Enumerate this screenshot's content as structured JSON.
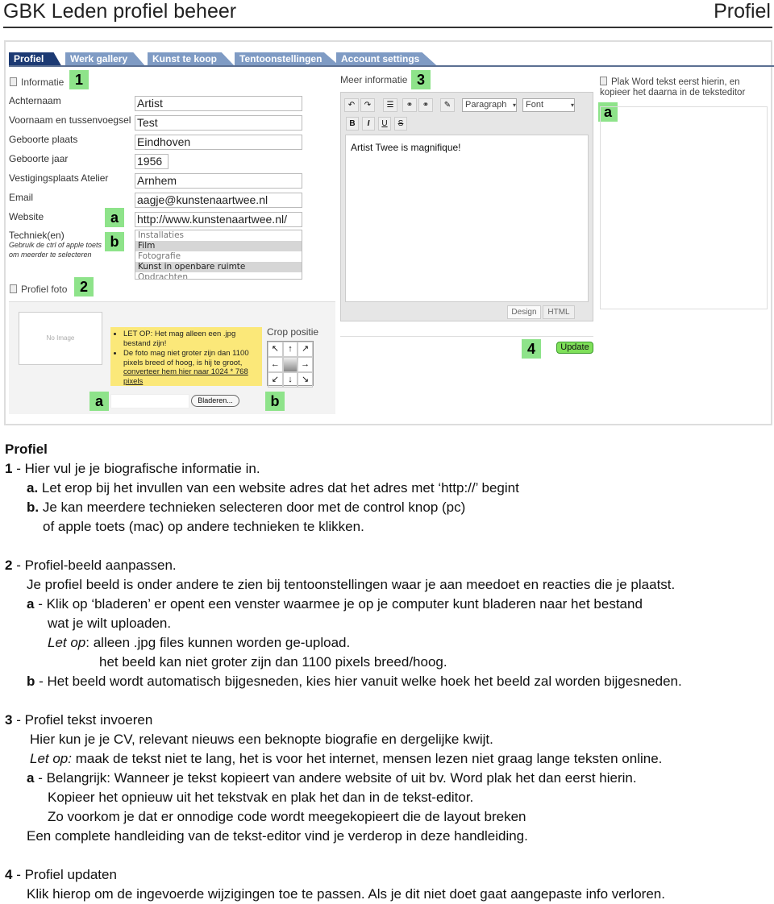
{
  "header": {
    "title": "GBK Leden profiel beheer",
    "right": "Profiel"
  },
  "tabs": [
    {
      "label": "Profiel",
      "active": true
    },
    {
      "label": "Werk gallery"
    },
    {
      "label": "Kunst te koop"
    },
    {
      "label": "Tentoonstellingen"
    },
    {
      "label": "Account settings"
    }
  ],
  "info": {
    "heading": "Informatie",
    "badge": "1",
    "fields": [
      {
        "label": "Achternaam",
        "value": "Artist"
      },
      {
        "label": "Voornaam en tussenvoegsel",
        "value": "Test"
      },
      {
        "label": "Geboorte plaats",
        "value": "Eindhoven"
      },
      {
        "label": "Geboorte jaar",
        "value": "1956"
      },
      {
        "label": "Vestigingsplaats Atelier",
        "value": "Arnhem"
      },
      {
        "label": "Email",
        "value": "aagje@kunstenaartwee.nl"
      },
      {
        "label": "Website",
        "value": "http://www.kunstenaartwee.nl/",
        "badge": "a"
      }
    ],
    "techniek": {
      "label": "Techniek(en)",
      "hint": "Gebruik de ctrl of apple toets om meerder te selecteren",
      "badge": "b",
      "options": [
        {
          "label": "Installaties",
          "selected": false
        },
        {
          "label": "Film",
          "selected": true
        },
        {
          "label": "Fotografie",
          "selected": false
        },
        {
          "label": "Kunst in openbare ruimte",
          "selected": true
        },
        {
          "label": "Opdrachten",
          "selected": false
        }
      ]
    }
  },
  "photo": {
    "heading": "Profiel foto",
    "badge": "2",
    "no_image": "No Image",
    "notes": [
      "LET OP: Het mag alleen een .jpg bestand zijn!",
      "De foto mag niet groter zijn dan 1100 pixels breed of hoog, is hij te groot,"
    ],
    "note_link": "converteer hem hier naar 1024 * 768 pixels",
    "crop_label": "Crop positie",
    "browse": "Bladeren...",
    "badge_a": "a",
    "badge_b": "b"
  },
  "editor": {
    "heading": "Meer informatie",
    "badge": "3",
    "paragraph": "Paragraph",
    "font": "Font",
    "bold": "B",
    "italic": "I",
    "underline": "U",
    "strike": "S",
    "content": "Artist Twee is magnifique!",
    "design_tab": "Design",
    "html_tab": "HTML"
  },
  "paste": {
    "label": "Plak Word tekst eerst hierin, en kopieer het daarna in de teksteditor",
    "badge": "a"
  },
  "update": {
    "label": "Update",
    "badge": "4"
  },
  "doc": {
    "title": "Profiel",
    "l1p": "1",
    "l1": " - Hier vul je je biografische informatie in.",
    "l2p": "a.",
    "l2": " Let erop bij het invullen van een website adres dat het adres met ‘http://’ begint",
    "l3p": "b.",
    "l3": " Je kan meerdere technieken selecteren door met de control knop (pc)",
    "l4": "of apple toets (mac) op andere technieken te klikken.",
    "l5p": "2",
    "l5": " - Profiel-beeld aanpassen.",
    "l6": "Je profiel beeld is onder andere te zien bij tentoonstellingen waar je aan meedoet en reacties die je plaatst.",
    "l7p": "a",
    "l7": " - Klik op ‘bladeren’ er opent een venster waarmee je op je computer kunt bladeren naar het bestand",
    "l8": "wat je wilt uploaden.",
    "l9i": "Let op",
    "l9": ": alleen .jpg files kunnen worden ge-upload.",
    "l10": "het beeld kan niet groter zijn dan 1100 pixels breed/hoog.",
    "l11p": "b",
    "l11": " - Het beeld wordt automatisch bijgesneden, kies hier vanuit welke hoek het beeld zal worden bijgesneden.",
    "l12p": "3",
    "l12": " - Profiel tekst invoeren",
    "l13": "Hier kun je je CV, relevant nieuws een beknopte biografie en dergelijke kwijt.",
    "l14i": "Let op:",
    "l14": " maak de tekst niet te lang, het is voor het internet, mensen lezen niet graag lange teksten online.",
    "l15p": "a",
    "l15": " - Belangrijk: Wanneer je tekst kopieert van andere website of uit bv. Word plak het dan eerst hierin.",
    "l16": "Kopieer het opnieuw uit het tekstvak en plak het dan in de tekst-editor.",
    "l17": "Zo voorkom je dat er onnodige code wordt meegekopieert die de layout breken",
    "l18": "Een complete handleiding van de tekst-editor vind je verderop in deze handleiding.",
    "l19p": "4",
    "l19": " - Profiel updaten",
    "l20": "Klik hierop om de ingevoerde wijzigingen toe te passen. Als je dit niet doet gaat aangepaste info verloren."
  }
}
